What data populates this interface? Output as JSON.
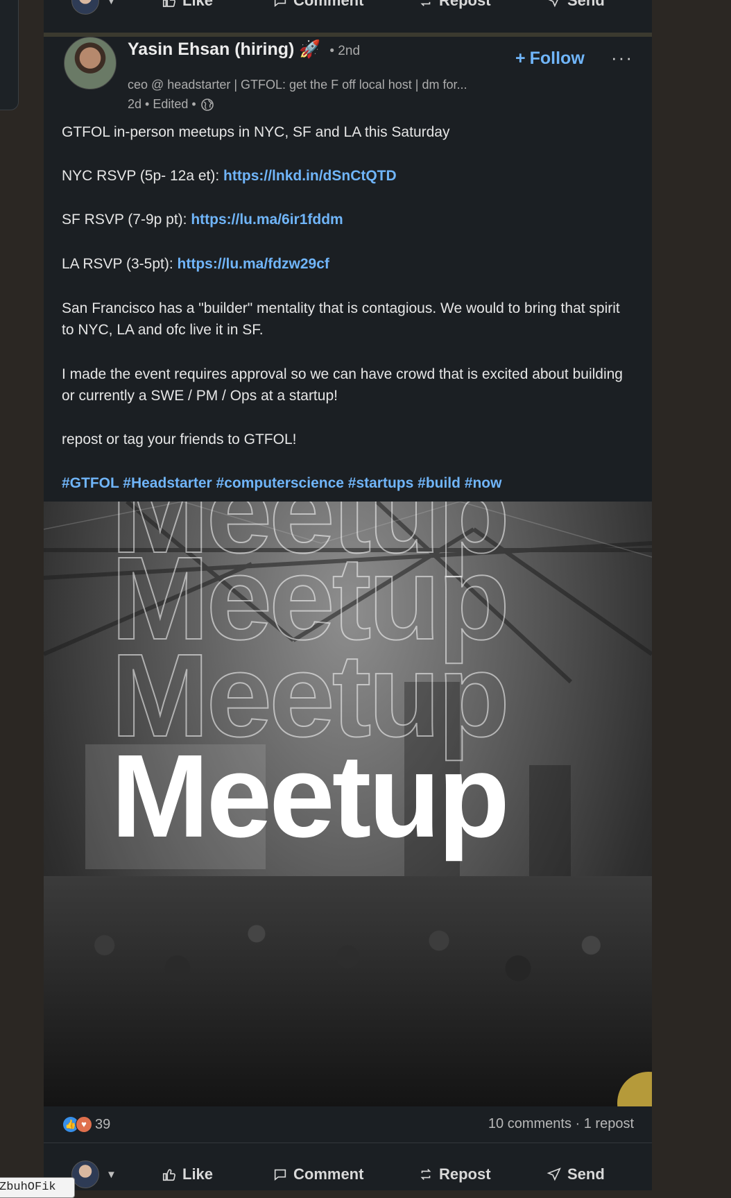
{
  "actions": {
    "like": "Like",
    "comment": "Comment",
    "repost": "Repost",
    "send": "Send"
  },
  "post": {
    "author": "Yasin Ehsan (hiring)",
    "author_emoji": "🚀",
    "degree": "• 2nd",
    "headline": "ceo @ headstarter | GTFOL: get the F off local host | dm for...",
    "time": "2d • Edited •",
    "follow": "Follow",
    "more": "···",
    "intro": "GTFOL in-person meetups in NYC, SF and LA this Saturday",
    "nyc_label": "NYC RSVP (5p- 12a et): ",
    "nyc_link": "https://lnkd.in/dSnCtQTD",
    "sf_label": "SF RSVP (7-9p pt): ",
    "sf_link": "https://lu.ma/6ir1fddm",
    "la_label": "LA RSVP (3-5pt): ",
    "la_link": "https://lu.ma/fdzw29cf",
    "para1": "San Francisco has a \"builder\" mentality that is contagious. We would to bring that spirit to NYC, LA and ofc live it in SF.",
    "para2": "I made the event requires approval so we can have crowd that is excited about building or currently a SWE / PM / Ops at a startup!",
    "para3": "repost or tag your friends to GTFOL!",
    "hashtags": "#GTFOL #Headstarter #computerscience #startups #build #now",
    "image_word": "Meetup"
  },
  "social": {
    "reaction_count": "39",
    "counts": "10 comments · 1 repost"
  },
  "tooltip": "ZbuhOFik"
}
